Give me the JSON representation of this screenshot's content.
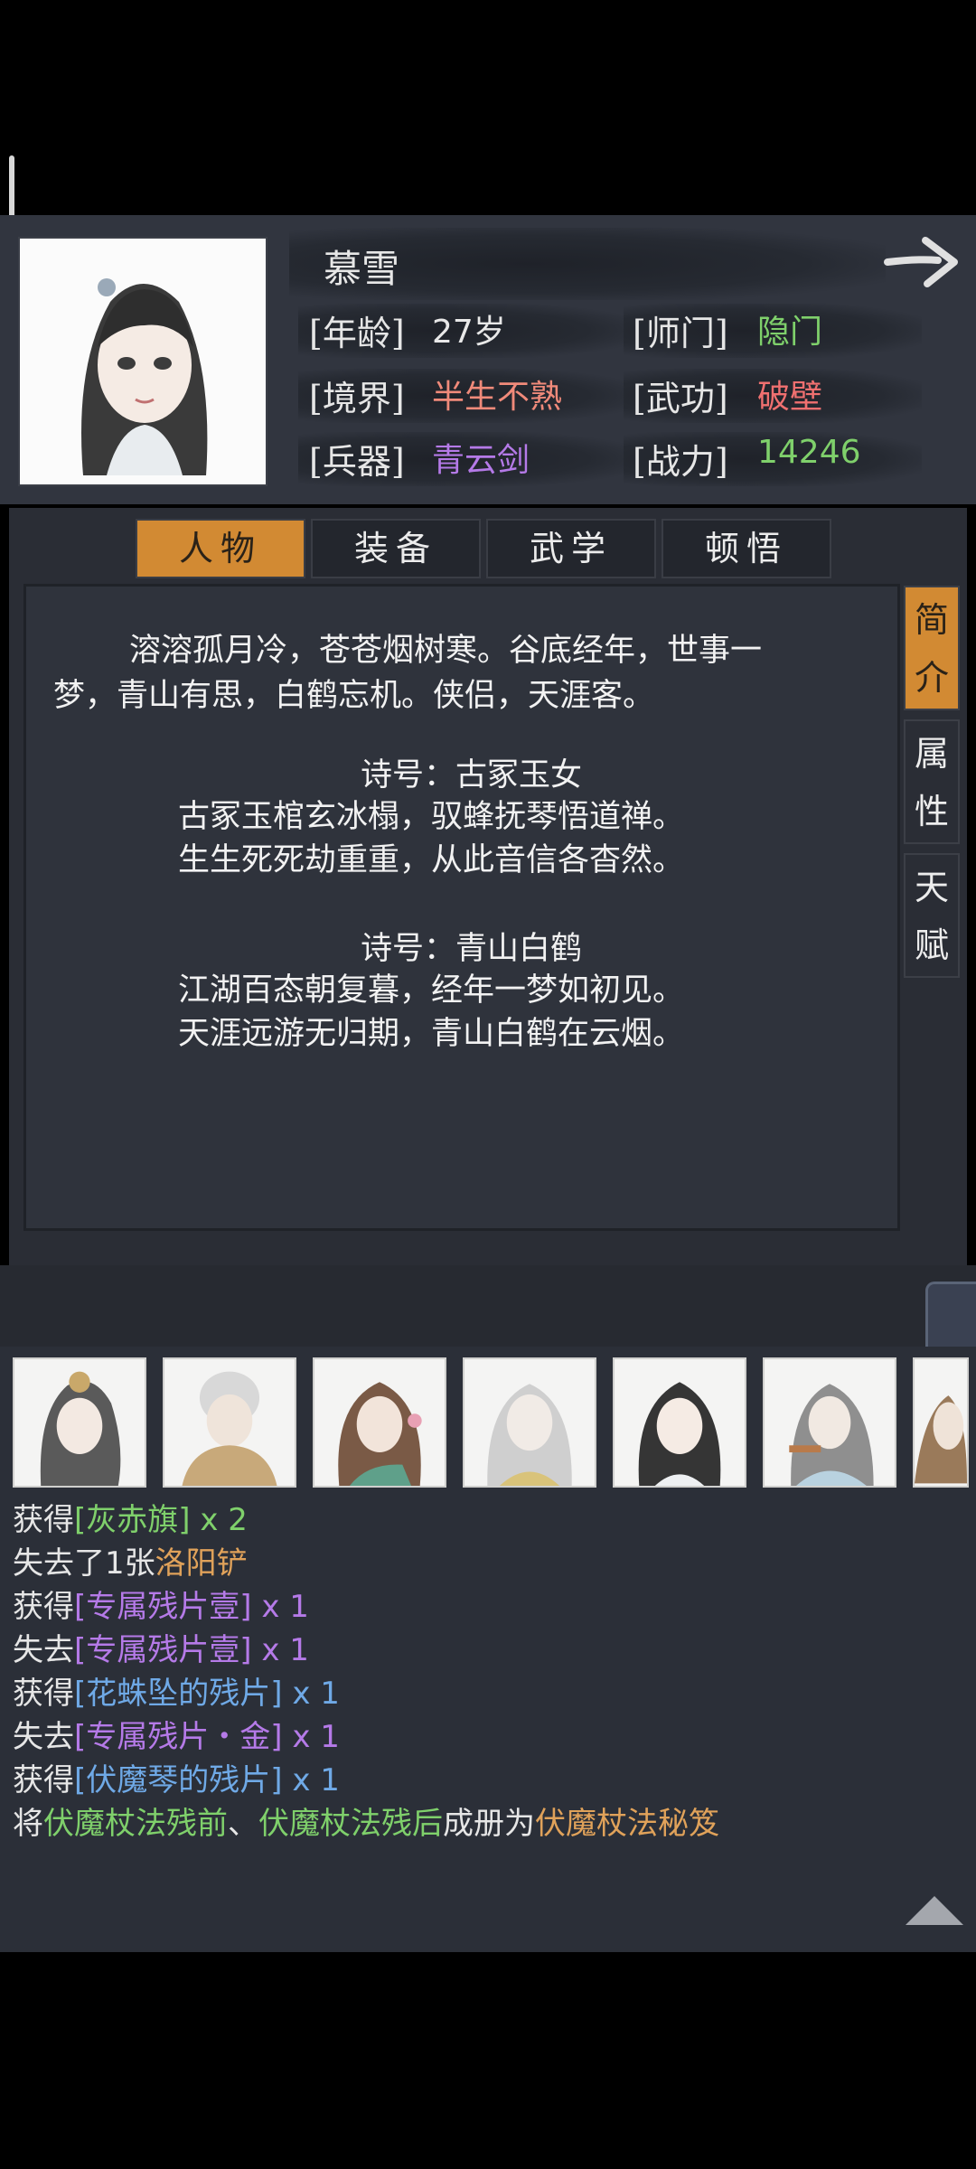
{
  "character": {
    "name": "慕雪",
    "stats": [
      {
        "label": "[年龄]",
        "value": "27岁",
        "color": "#e8e8e8"
      },
      {
        "label": "[师门]",
        "value": "隐门",
        "color": "#7fd06b"
      },
      {
        "label": "[境界]",
        "value": "半生不熟",
        "color": "#f08a7a"
      },
      {
        "label": "[武功]",
        "value": "破壁",
        "color": "#f07070"
      },
      {
        "label": "[兵器]",
        "value": "青云剑",
        "color": "#b57ae8"
      },
      {
        "label": "[战力]",
        "value": "14246",
        "color": "#7fd06b"
      }
    ]
  },
  "tabs": [
    "人物",
    "装备",
    "武学",
    "顿悟"
  ],
  "active_tab": 0,
  "side_tabs": [
    {
      "label": "简介",
      "active": true
    },
    {
      "label": "属性",
      "active": false
    },
    {
      "label": "天赋",
      "active": false
    }
  ],
  "story": {
    "intro_line1": "溶溶孤月冷，苍苍烟树寒。谷底经年，世事一",
    "intro_line2": "梦，青山有思，白鹤忘机。侠侣，天涯客。",
    "poem1_title": "诗号：古冢玉女",
    "poem1_line1": "古冢玉棺玄冰榻，驭蜂抚琴悟道禅。",
    "poem1_line2": "生生死死劫重重，从此音信各杳然。",
    "poem2_title": "诗号：青山白鹤",
    "poem2_line1": "江湖百态朝复暮，经年一梦如初见。",
    "poem2_line2": "天涯远游无归期，青山白鹤在云烟。"
  },
  "log": [
    [
      {
        "t": "获得",
        "c": ""
      },
      {
        "t": "[灰赤旗]",
        "c": "g"
      },
      {
        "t": " x 2",
        "c": "g"
      }
    ],
    [
      {
        "t": "失去了1张",
        "c": ""
      },
      {
        "t": "洛阳铲",
        "c": "o"
      }
    ],
    [
      {
        "t": "获得",
        "c": ""
      },
      {
        "t": "[专属残片壹]",
        "c": "p"
      },
      {
        "t": " x 1",
        "c": "p"
      }
    ],
    [
      {
        "t": "失去",
        "c": ""
      },
      {
        "t": "[专属残片壹]",
        "c": "p"
      },
      {
        "t": " x 1",
        "c": "p"
      }
    ],
    [
      {
        "t": "获得",
        "c": ""
      },
      {
        "t": "[花蛛坠的残片]",
        "c": "b"
      },
      {
        "t": " x 1",
        "c": "b"
      }
    ],
    [
      {
        "t": "失去",
        "c": ""
      },
      {
        "t": "[专属残片・金]",
        "c": "p"
      },
      {
        "t": " x 1",
        "c": "p"
      }
    ],
    [
      {
        "t": "获得",
        "c": ""
      },
      {
        "t": "[伏魔琴的残片]",
        "c": "b"
      },
      {
        "t": " x 1",
        "c": "b"
      }
    ],
    [
      {
        "t": "将",
        "c": ""
      },
      {
        "t": "伏魔杖法残前",
        "c": "g"
      },
      {
        "t": "、",
        "c": ""
      },
      {
        "t": "伏魔杖法残后",
        "c": "g"
      },
      {
        "t": "成册为",
        "c": ""
      },
      {
        "t": "伏魔杖法秘笈",
        "c": "o"
      }
    ]
  ],
  "icons": {
    "next": "right-arrow-icon",
    "scroll_up": "triangle-up-icon"
  },
  "colors": {
    "accent": "#d28a33",
    "panel": "#2a2d35",
    "background": "#000000"
  }
}
